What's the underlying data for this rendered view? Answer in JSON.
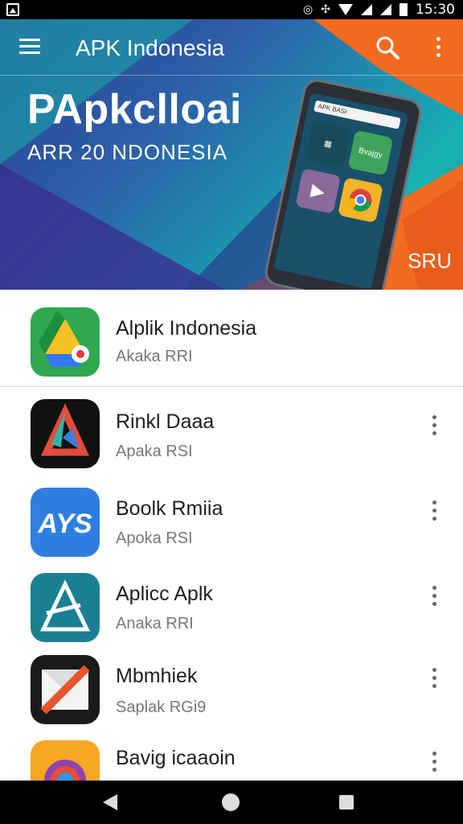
{
  "status_bar": {
    "time": "15:30"
  },
  "app_bar": {
    "title": "APK Indonesia"
  },
  "banner": {
    "headline": "PApkclloai",
    "subline": "ARR 20 NDONESIA",
    "badge": "SRU",
    "phone_search": "APK BASI",
    "tile_label": "Bvajgy"
  },
  "apps": [
    {
      "name": "Alplik Indonesia",
      "sub": "Akaka RRI"
    },
    {
      "name": "Rinkl Daaa",
      "sub": "Apaka RSI"
    },
    {
      "name": "Boolk Rmiia",
      "sub": "Apoka RSI"
    },
    {
      "name": "Aplicc Aplk",
      "sub": "Anaka RRI"
    },
    {
      "name": "Mbmhiek",
      "sub": "Saplak RGi9"
    },
    {
      "name": "Bavig icaaoin",
      "sub": ""
    }
  ],
  "icons": {
    "menu": "menu-icon",
    "search": "search-icon",
    "more": "more-vert-icon",
    "back": "back-icon",
    "home": "home-icon",
    "recents": "recents-icon"
  },
  "colors": {
    "accent_orange": "#f26b21",
    "teal": "#17b3b3",
    "blue": "#2d5fa8"
  }
}
